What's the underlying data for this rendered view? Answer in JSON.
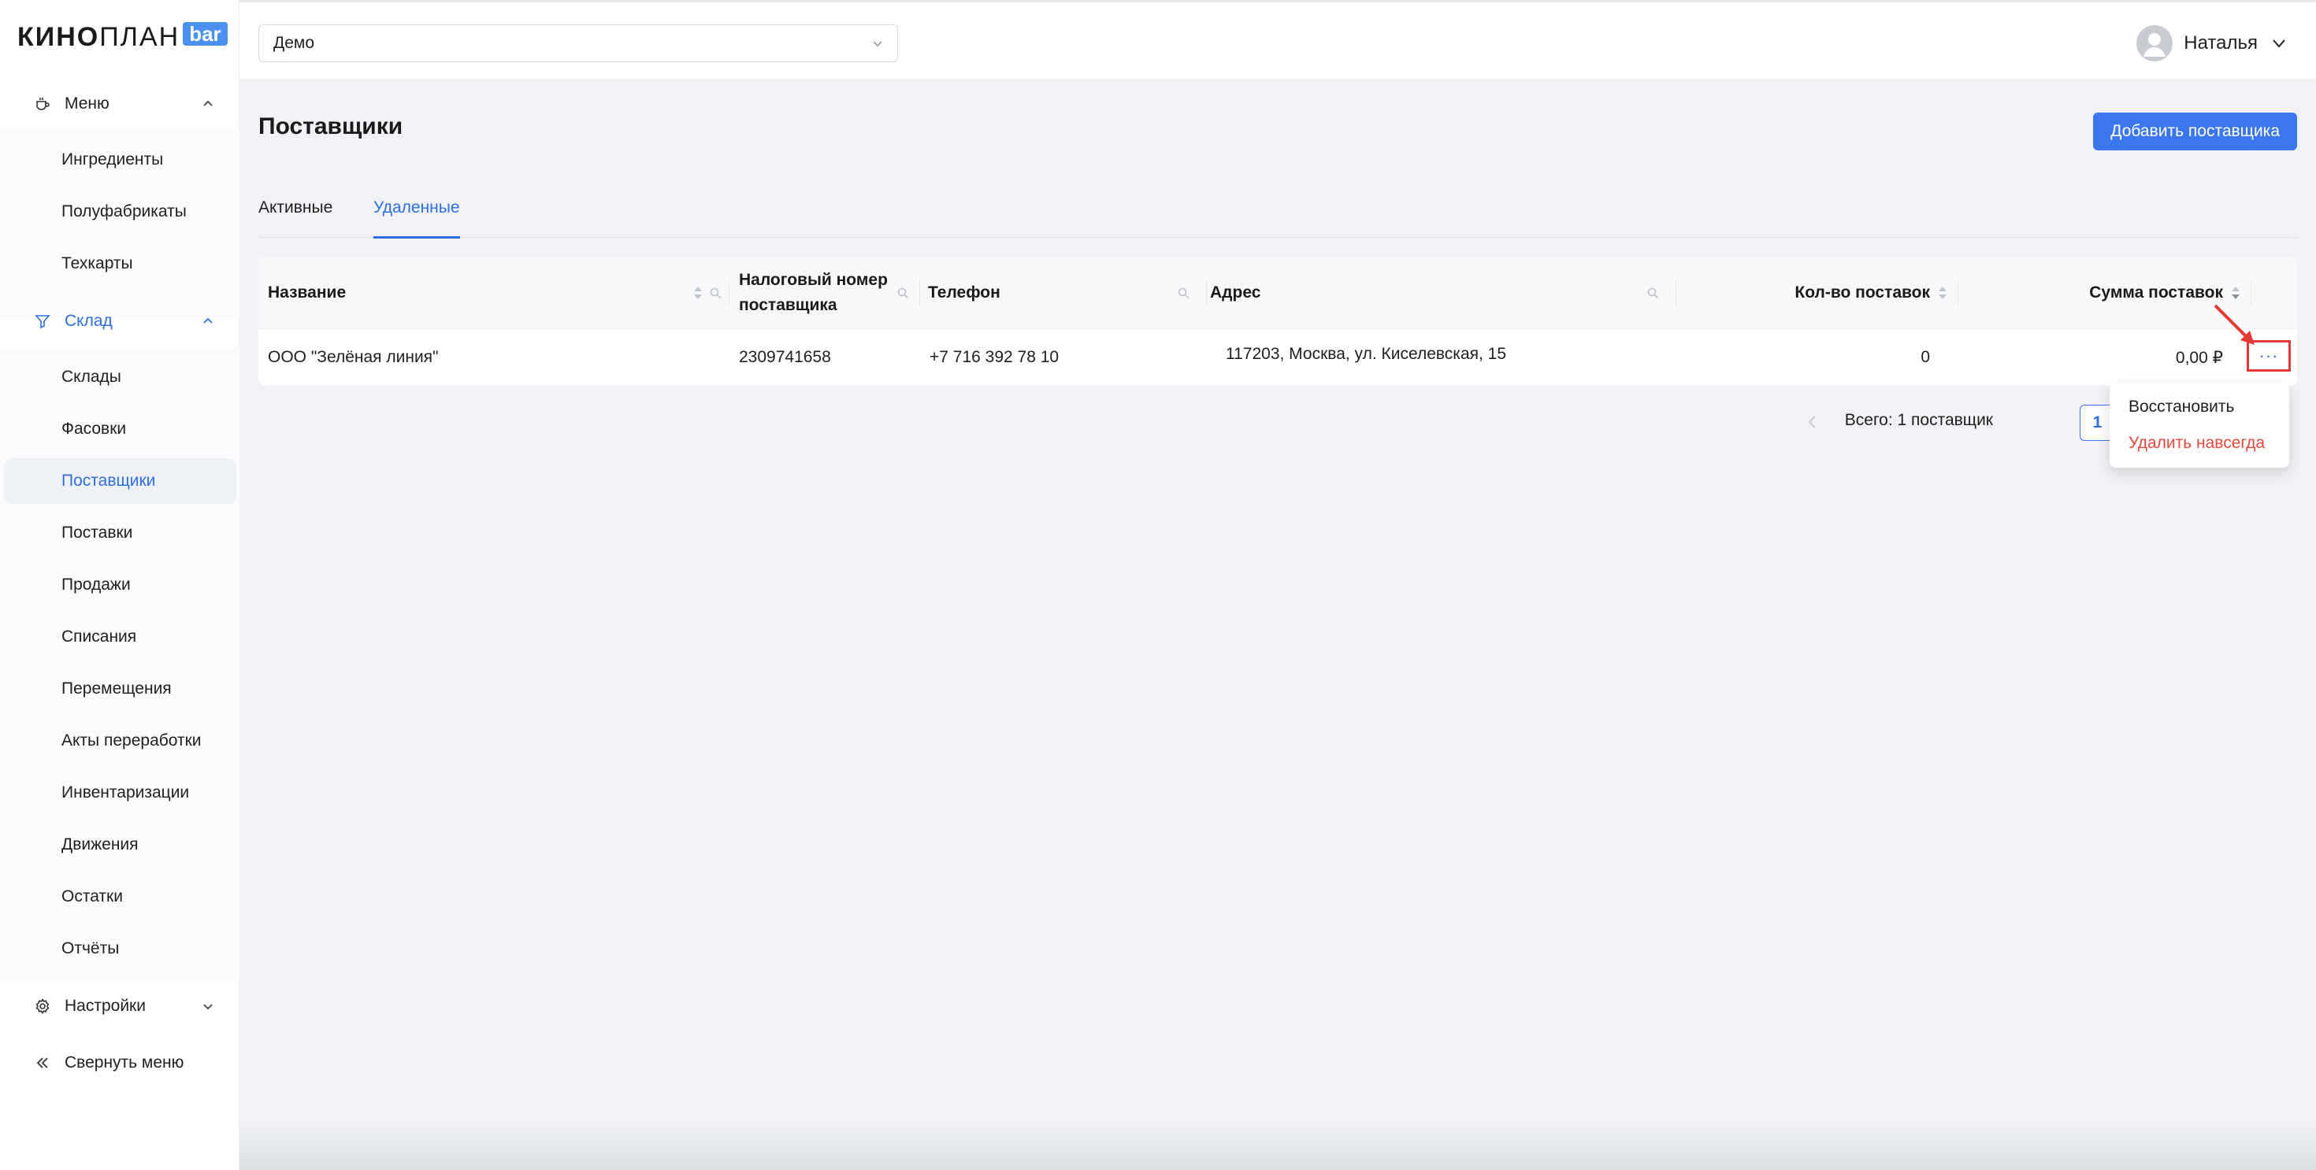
{
  "brand": {
    "part1": "КИНО",
    "part2": "ПЛАН",
    "badge": "bar",
    "accent": "#4a90f0"
  },
  "sidebar": {
    "menu": {
      "label": "Меню",
      "items": [
        "Ингредиенты",
        "Полуфабрикаты",
        "Техкарты"
      ]
    },
    "warehouse": {
      "label": "Склад",
      "items": [
        "Склады",
        "Фасовки",
        "Поставщики",
        "Поставки",
        "Продажи",
        "Списания",
        "Перемещения",
        "Акты переработки",
        "Инвентаризации",
        "Движения",
        "Остатки",
        "Отчёты"
      ],
      "selected": "Поставщики"
    },
    "settings": {
      "label": "Настройки"
    },
    "collapse": {
      "label": "Свернуть меню"
    }
  },
  "topbar": {
    "select_value": "Демо",
    "user_name": "Наталья"
  },
  "page": {
    "title": "Поставщики",
    "add_button": "Добавить поставщика",
    "tabs": [
      {
        "label": "Активные",
        "active": false
      },
      {
        "label": "Удаленные",
        "active": true
      }
    ]
  },
  "table": {
    "columns": [
      "Название",
      "Налоговый номер поставщика",
      "Телефон",
      "Адрес",
      "Кол-во поставок",
      "Сумма поставок"
    ],
    "rows": [
      {
        "name": "ООО \"Зелёная линия\"",
        "tax_id": "2309741658",
        "phone": "+7 716 392 78 10",
        "address": "117203, Москва, ул. Киселевская, 15",
        "count": "0",
        "sum": "0,00 ₽"
      }
    ],
    "more_label": "···"
  },
  "pagination": {
    "total": "Всего: 1 поставщик",
    "current_page": "1"
  },
  "row_menu": {
    "restore": "Восстановить",
    "delete_forever": "Удалить навсегда"
  },
  "colors": {
    "primary": "#3b78f0",
    "danger": "#e5483b",
    "annotation": "#e53935"
  }
}
